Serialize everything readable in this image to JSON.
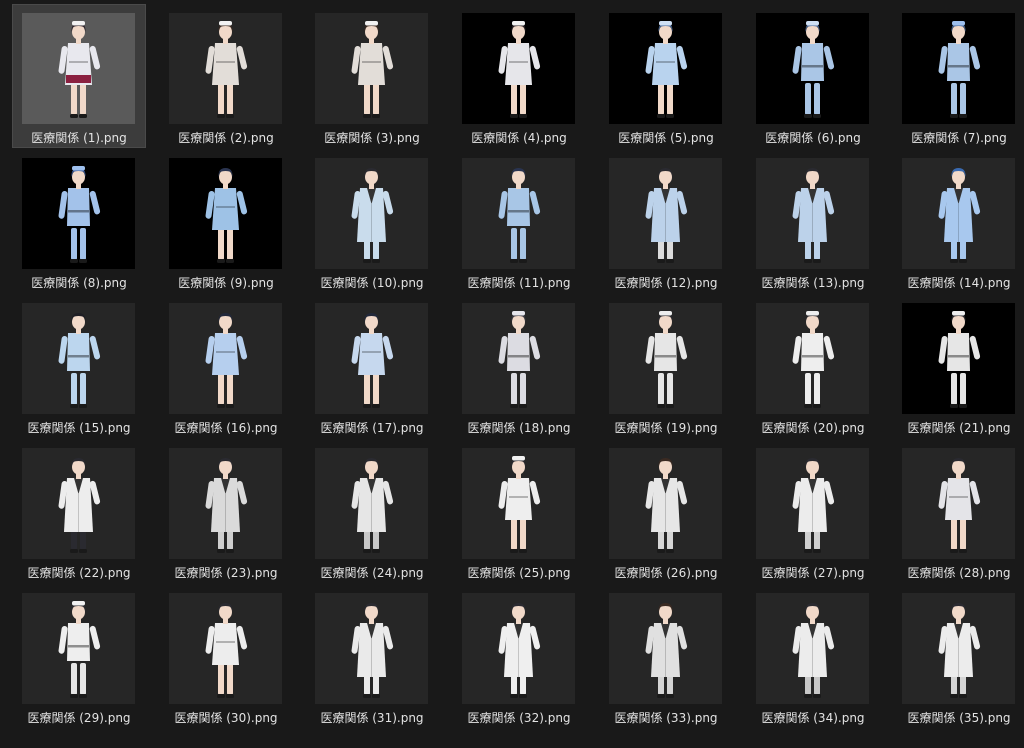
{
  "files": [
    {
      "name": "医療関係 (1).png",
      "selected": true,
      "bg": "#5a5a5a",
      "outfit": "nurse-dress",
      "top": "#e8e8ee",
      "bottom": "#8b2040",
      "hair": "#2a2028",
      "cap": "#f2f2f2"
    },
    {
      "name": "医療関係 (2).png",
      "selected": false,
      "bg": "#262626",
      "outfit": "nurse-dress",
      "top": "#e2ddd8",
      "bottom": "#e2ddd8",
      "hair": "#3a2a22",
      "cap": "#f2f2f2"
    },
    {
      "name": "医療関係 (3).png",
      "selected": false,
      "bg": "#262626",
      "outfit": "nurse-dress",
      "top": "#e2ddd8",
      "bottom": "#e2ddd8",
      "hair": "#3a2a22",
      "cap": "#f2f2f2"
    },
    {
      "name": "医療関係 (4).png",
      "selected": false,
      "bg": "#000000",
      "outfit": "nurse-dress",
      "top": "#e6e6ea",
      "bottom": "#e6e6ea",
      "hair": "#2a2226",
      "cap": "#f2f2f2"
    },
    {
      "name": "医療関係 (5).png",
      "selected": false,
      "bg": "#000000",
      "outfit": "dress",
      "top": "#b9d3ee",
      "bottom": "#b9d3ee",
      "hair": "#4a6a9a",
      "cap": "#cfe0f4"
    },
    {
      "name": "医療関係 (6).png",
      "selected": false,
      "bg": "#000000",
      "outfit": "pants",
      "top": "#aac6e6",
      "bottom": "#aac6e6",
      "hair": "#4a6a9a",
      "cap": "#cfe0f4"
    },
    {
      "name": "医療関係 (7).png",
      "selected": false,
      "bg": "#000000",
      "outfit": "pants",
      "top": "#aac6e6",
      "bottom": "#aac6e6",
      "hair": "#4a6a9a",
      "cap": "#9ec0ee"
    },
    {
      "name": "医療関係 (8).png",
      "selected": false,
      "bg": "#000000",
      "outfit": "pants",
      "top": "#a3c2ea",
      "bottom": "#a3c2ea",
      "hair": "#3a5a9a",
      "cap": "#9ec0ee"
    },
    {
      "name": "医療関係 (9).png",
      "selected": false,
      "bg": "#000000",
      "outfit": "dress",
      "top": "#9ec2e6",
      "bottom": "#9ec2e6",
      "hair": "#2a3450",
      "cap": ""
    },
    {
      "name": "医療関係 (10).png",
      "selected": false,
      "bg": "#262626",
      "outfit": "coat",
      "top": "#c9dcec",
      "bottom": "#c9dcec",
      "hair": "#2a2a30",
      "cap": ""
    },
    {
      "name": "医療関係 (11).png",
      "selected": false,
      "bg": "#262626",
      "outfit": "pants",
      "top": "#a8c6e6",
      "bottom": "#a8c6e6",
      "hair": "#2a3450",
      "cap": ""
    },
    {
      "name": "医療関係 (12).png",
      "selected": false,
      "bg": "#262626",
      "outfit": "coat",
      "top": "#bcd2ea",
      "bottom": "#dcdcdc",
      "hair": "#2a2a30",
      "cap": ""
    },
    {
      "name": "医療関係 (13).png",
      "selected": false,
      "bg": "#262626",
      "outfit": "coat",
      "top": "#bcd2ea",
      "bottom": "#bcd2ea",
      "hair": "#2a2a30",
      "cap": ""
    },
    {
      "name": "医療関係 (14).png",
      "selected": false,
      "bg": "#262626",
      "outfit": "coat",
      "top": "#a8c8ee",
      "bottom": "#a8c8ee",
      "hair": "#3a6ab0",
      "cap": ""
    },
    {
      "name": "医療関係 (15).png",
      "selected": false,
      "bg": "#262626",
      "outfit": "pants",
      "top": "#bcd6ee",
      "bottom": "#bcd6ee",
      "hair": "#1e1e24",
      "cap": ""
    },
    {
      "name": "医療関係 (16).png",
      "selected": false,
      "bg": "#262626",
      "outfit": "dress",
      "top": "#b6cfee",
      "bottom": "#b6cfee",
      "hair": "#22283a",
      "cap": ""
    },
    {
      "name": "医療関係 (17).png",
      "selected": false,
      "bg": "#262626",
      "outfit": "dress",
      "top": "#c6d8ee",
      "bottom": "#c6d8ee",
      "hair": "#22283a",
      "cap": ""
    },
    {
      "name": "医療関係 (18).png",
      "selected": false,
      "bg": "#262626",
      "outfit": "pants",
      "top": "#dcdce2",
      "bottom": "#dcdce2",
      "hair": "#3a3a44",
      "cap": "#e6e6ec"
    },
    {
      "name": "医療関係 (19).png",
      "selected": false,
      "bg": "#262626",
      "outfit": "pants",
      "top": "#e6e6e6",
      "bottom": "#e6e6e6",
      "hair": "#2a2a30",
      "cap": "#eeeeee"
    },
    {
      "name": "医療関係 (20).png",
      "selected": false,
      "bg": "#262626",
      "outfit": "pants",
      "top": "#eeeeee",
      "bottom": "#eeeeee",
      "hair": "#2a2a30",
      "cap": "#eeeeee"
    },
    {
      "name": "医療関係 (21).png",
      "selected": false,
      "bg": "#000000",
      "outfit": "pants",
      "top": "#e6e6e6",
      "bottom": "#e6e6e6",
      "hair": "#2a2a30",
      "cap": "#eeeeee"
    },
    {
      "name": "医療関係 (22).png",
      "selected": false,
      "bg": "#262626",
      "outfit": "coat",
      "top": "#ededed",
      "bottom": "#2a2a30",
      "hair": "#2a2a30",
      "cap": ""
    },
    {
      "name": "医療関係 (23).png",
      "selected": false,
      "bg": "#262626",
      "outfit": "coat",
      "top": "#dadada",
      "bottom": "#cfcfcf",
      "hair": "#2a2a30",
      "cap": ""
    },
    {
      "name": "医療関係 (24).png",
      "selected": false,
      "bg": "#262626",
      "outfit": "coat",
      "top": "#e6e6e6",
      "bottom": "#c8c8c8",
      "hair": "#2a2a30",
      "cap": ""
    },
    {
      "name": "医療関係 (25).png",
      "selected": false,
      "bg": "#262626",
      "outfit": "nurse-dress",
      "top": "#eeeeee",
      "bottom": "#eeeeee",
      "hair": "#2a2a30",
      "cap": "#f2f2f2"
    },
    {
      "name": "医療関係 (26).png",
      "selected": false,
      "bg": "#262626",
      "outfit": "coat",
      "top": "#e6e6e6",
      "bottom": "#d6d6d6",
      "hair": "#3a2a22",
      "cap": ""
    },
    {
      "name": "医療関係 (27).png",
      "selected": false,
      "bg": "#262626",
      "outfit": "coat",
      "top": "#ececec",
      "bottom": "#d0d0d0",
      "hair": "#2a2a30",
      "cap": ""
    },
    {
      "name": "医療関係 (28).png",
      "selected": false,
      "bg": "#262626",
      "outfit": "dress",
      "top": "#e4e4e8",
      "bottom": "#e4e4e8",
      "hair": "#2a2a30",
      "cap": ""
    },
    {
      "name": "医療関係 (29).png",
      "selected": false,
      "bg": "#262626",
      "outfit": "pants",
      "top": "#eeeeee",
      "bottom": "#e6e6e6",
      "hair": "#2a2a30",
      "cap": "#f2f2f2"
    },
    {
      "name": "医療関係 (30).png",
      "selected": false,
      "bg": "#262626",
      "outfit": "dress",
      "top": "#ededed",
      "bottom": "#ededed",
      "hair": "#2a2a30",
      "cap": ""
    },
    {
      "name": "医療関係 (31).png",
      "selected": false,
      "bg": "#262626",
      "outfit": "coat",
      "top": "#eaeaea",
      "bottom": "#eaeaea",
      "hair": "#2a2a30",
      "cap": ""
    },
    {
      "name": "医療関係 (32).png",
      "selected": false,
      "bg": "#262626",
      "outfit": "coat",
      "top": "#efefef",
      "bottom": "#efefef",
      "hair": "#2a2a30",
      "cap": ""
    },
    {
      "name": "医療関係 (33).png",
      "selected": false,
      "bg": "#262626",
      "outfit": "coat",
      "top": "#e0e0e0",
      "bottom": "#d4d4d4",
      "hair": "#3a2a22",
      "cap": ""
    },
    {
      "name": "医療関係 (34).png",
      "selected": false,
      "bg": "#262626",
      "outfit": "coat",
      "top": "#ececec",
      "bottom": "#c8c8c8",
      "hair": "#2a2a30",
      "cap": ""
    },
    {
      "name": "医療関係 (35).png",
      "selected": false,
      "bg": "#262626",
      "outfit": "coat",
      "top": "#ececec",
      "bottom": "#d4d4d4",
      "hair": "#2a2a30",
      "cap": ""
    }
  ],
  "colors": {
    "background": "#191919",
    "selected_tile": "#3c3c3c",
    "label_text": "#e3e3e3",
    "skin": "#f1d9c9"
  }
}
